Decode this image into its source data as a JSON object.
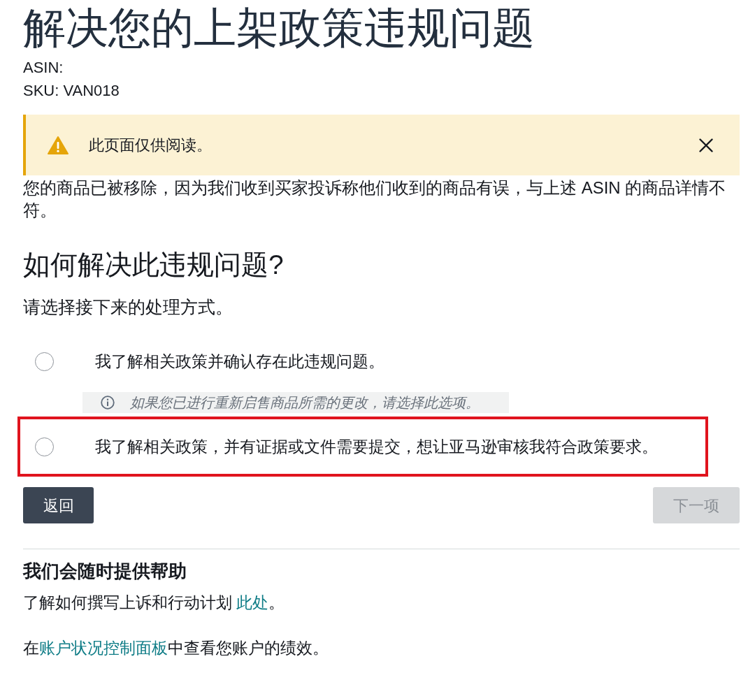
{
  "page": {
    "title": "解决您的上架政策违规问题",
    "meta": [
      "ASIN:",
      "SKU: VAN018"
    ]
  },
  "alert": {
    "kind": "warning",
    "text": "此页面仅供阅读。",
    "dismissible": true
  },
  "description": "您的商品已被移除，因为我们收到买家投诉称他们收到的商品有误，与上述 ASIN 的商品详情不符。",
  "resolution": {
    "heading": "如何解决此违规问题?",
    "prompt": "请选择接下来的处理方式。",
    "options": [
      {
        "label": "我了解相关政策并确认存在此违规问题。",
        "selected": false,
        "highlighted": false,
        "hint": "如果您已进行重新启售商品所需的更改，请选择此选项。"
      },
      {
        "label": "我了解相关政策，并有证据或文件需要提交，想让亚马逊审核我符合政策要求。",
        "selected": false,
        "highlighted": true
      }
    ]
  },
  "buttons": [
    {
      "label": "返回",
      "disabled": false
    },
    {
      "label": "下一项",
      "disabled": true
    }
  ],
  "help": {
    "heading": "我们会随时提供帮助",
    "lines": [
      {
        "parts": [
          {
            "kind": "text",
            "text": "了解如何撰写上诉和行动计划 "
          },
          {
            "kind": "link",
            "text": "此处"
          },
          {
            "kind": "text",
            "text": "。"
          }
        ]
      },
      {
        "parts": [
          {
            "kind": "text",
            "text": "在"
          },
          {
            "kind": "link",
            "text": "账户状况控制面板"
          },
          {
            "kind": "text",
            "text": "中查看您账户的绩效。"
          }
        ]
      }
    ]
  }
}
